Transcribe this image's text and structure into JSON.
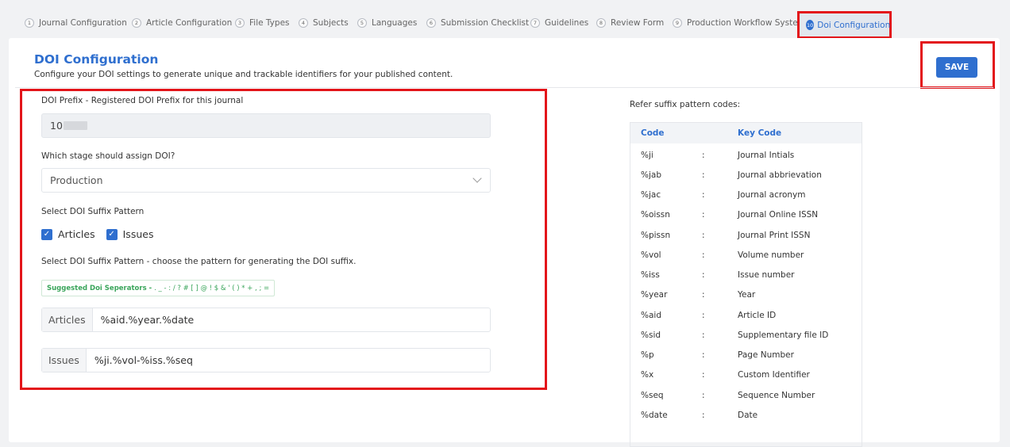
{
  "tabs": [
    {
      "num": "1",
      "label": "Journal Configuration"
    },
    {
      "num": "2",
      "label": "Article Configuration"
    },
    {
      "num": "3",
      "label": "File Types"
    },
    {
      "num": "4",
      "label": "Subjects"
    },
    {
      "num": "5",
      "label": "Languages"
    },
    {
      "num": "6",
      "label": "Submission Checklist"
    },
    {
      "num": "7",
      "label": "Guidelines"
    },
    {
      "num": "8",
      "label": "Review Form"
    },
    {
      "num": "9",
      "label": "Production Workflow System"
    },
    {
      "num": "10",
      "label": "Doi Configuration"
    }
  ],
  "header": {
    "title": "DOI Configuration",
    "subtitle": "Configure your DOI settings to generate unique and trackable identifiers for your published content.",
    "save_label": "SAVE"
  },
  "form": {
    "prefix_label": "DOI Prefix - Registered DOI Prefix for this journal",
    "prefix_value": "10",
    "stage_label": "Which stage should assign DOI?",
    "stage_value": "Production",
    "suffix_label": "Select DOI Suffix Pattern",
    "check_articles": "Articles",
    "check_issues": "Issues",
    "pattern_label": "Select DOI Suffix Pattern - choose the pattern for generating the DOI suffix.",
    "separators_title": "Suggested Doi Seperators -",
    "separators_chars": ". _ - : / ? # [ ] @ ! $ & ' ( ) * + , ; =",
    "articles_addon": "Articles",
    "articles_value": "%aid.%year.%date",
    "issues_addon": "Issues",
    "issues_value": "%ji.%vol-%iss.%seq"
  },
  "reference": {
    "title": "Refer suffix pattern codes:",
    "col_code": "Code",
    "col_key": "Key Code",
    "colon": ":",
    "rows": [
      {
        "code": "%ji",
        "desc": "Journal Intials"
      },
      {
        "code": "%jab",
        "desc": "Journal abbrievation"
      },
      {
        "code": "%jac",
        "desc": "Journal acronym"
      },
      {
        "code": "%oissn",
        "desc": "Journal Online ISSN"
      },
      {
        "code": "%pissn",
        "desc": "Journal Print ISSN"
      },
      {
        "code": "%vol",
        "desc": "Volume number"
      },
      {
        "code": "%iss",
        "desc": "Issue number"
      },
      {
        "code": "%year",
        "desc": "Year"
      },
      {
        "code": "%aid",
        "desc": "Article ID"
      },
      {
        "code": "%sid",
        "desc": "Supplementary file ID"
      },
      {
        "code": "%p",
        "desc": "Page Number"
      },
      {
        "code": "%x",
        "desc": "Custom Identifier"
      },
      {
        "code": "%seq",
        "desc": "Sequence Number"
      },
      {
        "code": "%date",
        "desc": "Date"
      }
    ]
  },
  "colors": {
    "accent": "#2f6fcf",
    "highlight": "#e3151a",
    "separator_green": "#3aa55b"
  }
}
